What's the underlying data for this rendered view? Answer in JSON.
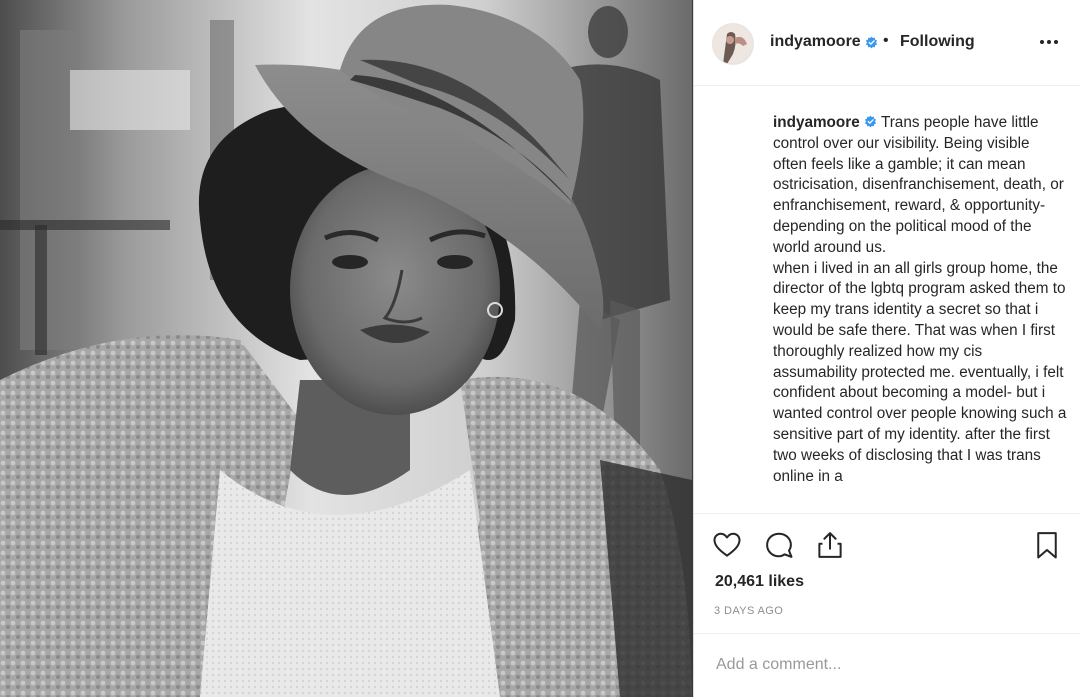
{
  "post": {
    "username": "indyamoore",
    "follow_status": "Following",
    "separator": "•",
    "caption_user": "indyamoore",
    "caption_text": "Trans people have little control over our visibility. Being visible often feels like a gamble; it can mean ostricisation, disenfranchisement, death, or enfranchisement, reward, & opportunity- depending on the political mood of the world around us.\nwhen i lived in an all girls group home, the director of the lgbtq program asked them to keep my trans identity a secret so that i would be safe there. That was when I first thoroughly realized how my cis assumability protected me. eventually, i felt confident about becoming a model- but i wanted control over people knowing such a sensitive part of my identity. after the first two weeks of disclosing that I was trans online in a",
    "likes": "20,461 likes",
    "date": "3 DAYS AGO",
    "comment_placeholder": "Add a comment..."
  },
  "icons": {
    "verified": "verified-badge-icon",
    "more": "more-options-icon",
    "like": "heart-icon",
    "comment": "comment-bubble-icon",
    "share": "share-upload-icon",
    "save": "bookmark-icon"
  },
  "colors": {
    "verified_blue": "#3897f0",
    "text": "#262626",
    "muted": "#8e8e8e"
  }
}
